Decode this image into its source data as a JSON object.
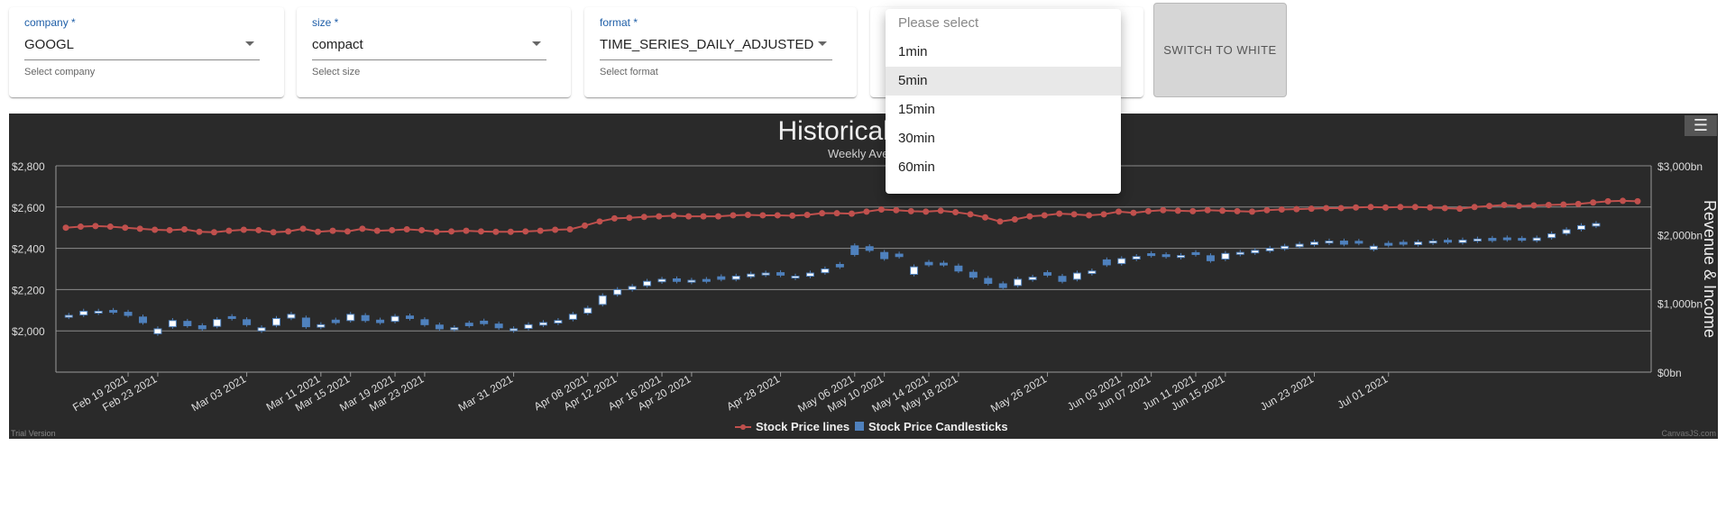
{
  "filters": {
    "company": {
      "label": "company *",
      "value": "GOOGL",
      "help": "Select company"
    },
    "size": {
      "label": "size *",
      "value": "compact",
      "help": "Select size"
    },
    "format": {
      "label": "format *",
      "value": "TIME_SERIES_DAILY_ADJUSTED",
      "help": "Select format"
    }
  },
  "switch_button": {
    "label": "SWITCH TO WHITE"
  },
  "dropdown": {
    "placeholder": "Please select",
    "options": [
      "1min",
      "5min",
      "15min",
      "30min",
      "60min"
    ],
    "highlighted": "5min"
  },
  "chart": {
    "title": "Historical data",
    "subtitle": "Weekly Avera",
    "menu_icon": "hamburger-icon",
    "trial_text": "Trial Version",
    "credit_text": "CanvasJS.com",
    "colors": {
      "background": "#2a2a2a",
      "line": "#c0504d",
      "candle": "#4f81bd",
      "candle_up": "#ffffff"
    }
  },
  "chart_data": {
    "type": "line",
    "title": "Historical data",
    "subtitle": "Weekly Avera",
    "y_left": {
      "ticks": [
        "$2,800",
        "$2,600",
        "$2,400",
        "$2,200",
        "$2,000"
      ],
      "range": [
        1800,
        2800
      ]
    },
    "y_right": {
      "label": "Revenue & Income",
      "ticks": [
        "$3,000bn",
        "$2,000bn",
        "$1,000bn",
        "$0bn"
      ],
      "range": [
        0,
        3000
      ]
    },
    "x_tick_labels": [
      "Feb 19 2021",
      "Feb 23 2021",
      "Mar 03 2021",
      "Mar 11 2021",
      "Mar 15 2021",
      "Mar 19 2021",
      "Mar 23 2021",
      "Mar 31 2021",
      "Apr 08 2021",
      "Apr 12 2021",
      "Apr 16 2021",
      "Apr 20 2021",
      "Apr 28 2021",
      "May 06 2021",
      "May 10 2021",
      "May 14 2021",
      "May 18 2021",
      "May 26 2021",
      "Jun 03 2021",
      "Jun 07 2021",
      "Jun 11 2021",
      "Jun 15 2021",
      "Jun 23 2021",
      "Jul 01 2021"
    ],
    "x_tick_index": [
      4,
      6,
      12,
      17,
      19,
      22,
      24,
      30,
      35,
      37,
      40,
      42,
      48,
      53,
      55,
      58,
      60,
      66,
      71,
      73,
      76,
      78,
      84,
      89
    ],
    "legend": [
      "Stock Price lines",
      "Stock Price Candlesticks"
    ],
    "line_series": {
      "name": "Stock Price lines",
      "values": [
        2500,
        2505,
        2508,
        2505,
        2500,
        2495,
        2490,
        2488,
        2492,
        2480,
        2478,
        2485,
        2490,
        2488,
        2478,
        2482,
        2495,
        2480,
        2485,
        2482,
        2495,
        2485,
        2488,
        2492,
        2488,
        2480,
        2482,
        2485,
        2482,
        2480,
        2480,
        2482,
        2485,
        2490,
        2492,
        2510,
        2530,
        2545,
        2548,
        2552,
        2555,
        2558,
        2555,
        2555,
        2555,
        2560,
        2562,
        2560,
        2560,
        2558,
        2562,
        2570,
        2570,
        2568,
        2578,
        2588,
        2585,
        2580,
        2578,
        2582,
        2575,
        2565,
        2550,
        2530,
        2540,
        2555,
        2560,
        2568,
        2565,
        2560,
        2565,
        2578,
        2572,
        2580,
        2585,
        2582,
        2580,
        2585,
        2582,
        2580,
        2578,
        2585,
        2588,
        2590,
        2592,
        2595,
        2595,
        2598,
        2600,
        2598,
        2600,
        2600,
        2598,
        2595,
        2592,
        2600,
        2605,
        2610,
        2605,
        2608,
        2610,
        2612,
        2615,
        2622,
        2628,
        2630,
        2628
      ],
      "note_units": "USD"
    },
    "candles": {
      "name": "Stock Price Candlesticks",
      "close": [
        2075,
        2095,
        2095,
        2090,
        2075,
        2040,
        2010,
        2050,
        2025,
        2010,
        2055,
        2060,
        2030,
        2015,
        2060,
        2080,
        2020,
        2030,
        2040,
        2080,
        2050,
        2040,
        2070,
        2060,
        2030,
        2010,
        2015,
        2025,
        2035,
        2015,
        2010,
        2030,
        2040,
        2050,
        2080,
        2110,
        2170,
        2200,
        2215,
        2240,
        2250,
        2240,
        2245,
        2240,
        2250,
        2265,
        2275,
        2280,
        2270,
        2265,
        2280,
        2300,
        2310,
        2370,
        2390,
        2350,
        2360,
        2310,
        2320,
        2320,
        2290,
        2260,
        2230,
        2210,
        2250,
        2260,
        2270,
        2240,
        2280,
        2290,
        2320,
        2350,
        2360,
        2365,
        2360,
        2365,
        2370,
        2340,
        2375,
        2380,
        2390,
        2400,
        2410,
        2420,
        2430,
        2435,
        2420,
        2425,
        2410,
        2415,
        2420,
        2430,
        2435,
        2430,
        2440,
        2445,
        2438,
        2442,
        2440,
        2450,
        2470,
        2490,
        2510,
        2520
      ],
      "up": [
        true,
        true,
        true,
        false,
        false,
        false,
        true,
        true,
        false,
        false,
        true,
        false,
        false,
        true,
        true,
        true,
        false,
        true,
        false,
        true,
        false,
        false,
        true,
        false,
        false,
        false,
        true,
        false,
        false,
        false,
        true,
        true,
        true,
        true,
        true,
        true,
        true,
        true,
        true,
        true,
        true,
        false,
        true,
        false,
        false,
        true,
        true,
        true,
        false,
        true,
        true,
        true,
        false,
        false,
        false,
        false,
        false,
        true,
        false,
        false,
        false,
        false,
        false,
        false,
        true,
        true,
        false,
        false,
        true,
        true,
        false,
        true,
        true,
        false,
        false,
        true,
        false,
        false,
        true,
        true,
        true,
        true,
        true,
        true,
        true,
        true,
        false,
        false,
        true,
        false,
        false,
        true,
        true,
        false,
        true,
        true,
        false,
        false,
        false,
        true,
        true,
        true,
        true,
        true
      ]
    }
  }
}
